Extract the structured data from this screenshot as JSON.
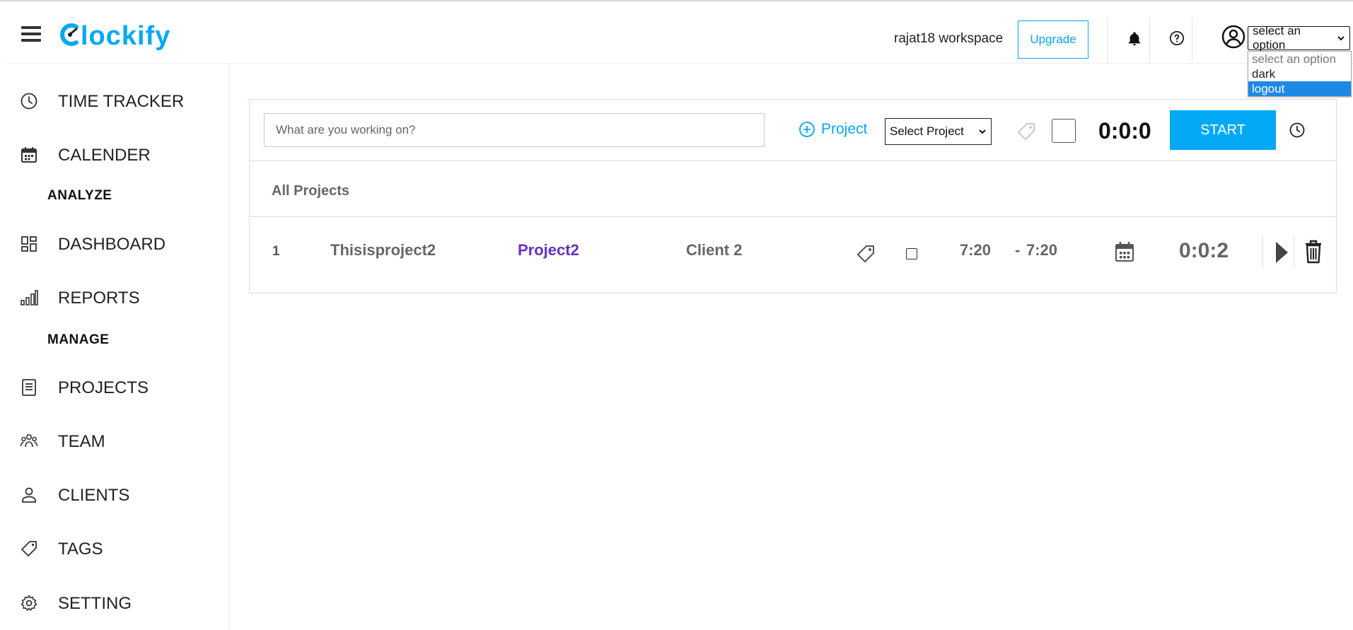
{
  "app": {
    "logo_text": "lockify",
    "brand_color": "#03a9f4"
  },
  "header": {
    "workspace": "rajat18 workspace",
    "upgrade_label": "Upgrade",
    "user_select": {
      "value": "select an option",
      "options": [
        "select an option",
        "dark",
        "logout"
      ],
      "highlighted": "logout"
    }
  },
  "sidebar": {
    "items": [
      {
        "label": "TIME TRACKER",
        "icon": "clock-icon"
      },
      {
        "label": "CALENDER",
        "icon": "calendar-icon"
      },
      {
        "heading": "ANALYZE"
      },
      {
        "label": "DASHBOARD",
        "icon": "dashboard-icon"
      },
      {
        "label": "REPORTS",
        "icon": "bar-chart-icon"
      },
      {
        "heading": "MANAGE"
      },
      {
        "label": "PROJECTS",
        "icon": "document-icon"
      },
      {
        "label": "TEAM",
        "icon": "team-icon"
      },
      {
        "label": "CLIENTS",
        "icon": "user-icon"
      },
      {
        "label": "TAGS",
        "icon": "tag-icon"
      },
      {
        "label": "SETTING",
        "icon": "gear-icon"
      }
    ]
  },
  "tracker": {
    "placeholder": "What are you working on?",
    "add_project_label": "Project",
    "project_select": "Select Project",
    "timer": "0:0:0",
    "start_label": "START"
  },
  "projects": {
    "title": "All Projects",
    "entries": [
      {
        "num": "1",
        "description": "Thisisproject2",
        "project": "Project2",
        "client": "Client 2",
        "start": "7:20",
        "dash": "-",
        "end": "7:20",
        "duration": "0:0:2",
        "project_color": "#6a2fc0"
      }
    ]
  },
  "colors": {
    "accent": "#03a9f4",
    "project": "#6a2fc0",
    "dropdown_highlight": "#1e88e5"
  }
}
